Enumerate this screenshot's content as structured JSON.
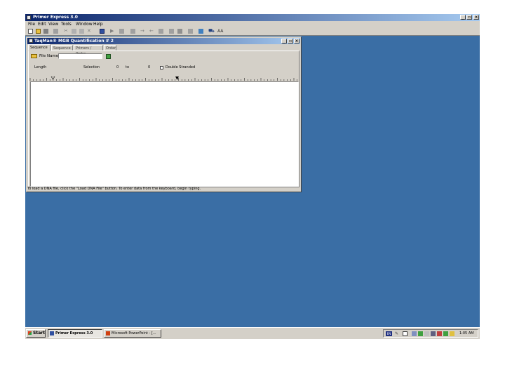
{
  "app": {
    "title": "Primer Express 3.0"
  },
  "menu": [
    "File",
    "Edit",
    "View",
    "Tools",
    "Window",
    "Help"
  ],
  "child_window": {
    "title": "TaqMan® MGB Quantification # 2",
    "tabs": [
      "Sequence",
      "Sequence",
      "Primers / Probe",
      "Order"
    ],
    "file_name_label": "File Name",
    "file_name_value": "",
    "length_label": "Length",
    "selection_label": "Selection",
    "selection_from": "0",
    "selection_to_label": "to",
    "selection_to": "0",
    "double_stranded_label": "Double Stranded",
    "status_text": "To load a DNA file, click the \"Load DNA File\" button. To enter data from the keyboard, begin typing."
  },
  "taskbar": {
    "start_label": "Start",
    "tasks": [
      "Primer Express 3.0",
      "Microsoft PowerPoint - [..."
    ],
    "clock": "1:05 AM",
    "lang": "EN"
  },
  "colors": {
    "desktop": "#3a6ea5",
    "title_active": "#0a246a",
    "face": "#d4d0c8"
  }
}
